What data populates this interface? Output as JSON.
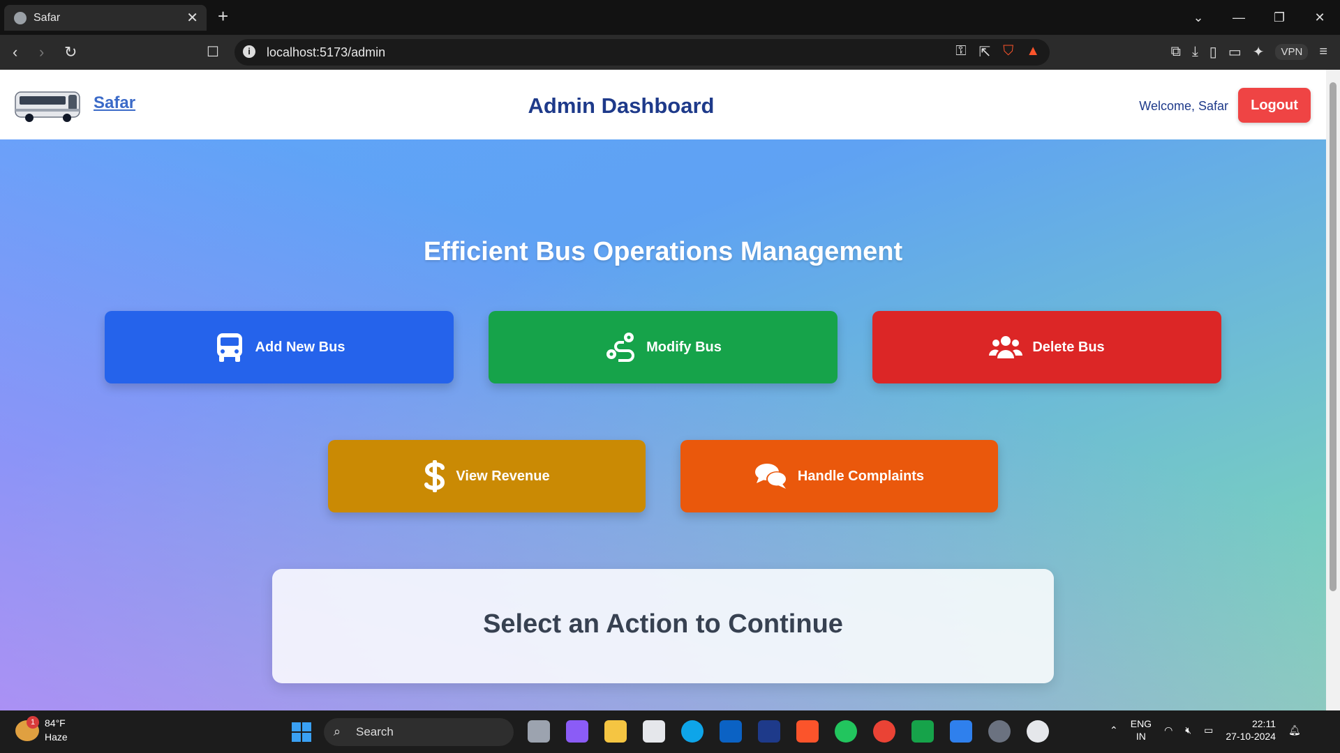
{
  "browser": {
    "tab_title": "Safar",
    "tab_close": "✕",
    "new_tab": "+",
    "url": "localhost:5173/admin",
    "vpn_label": "VPN",
    "window_controls": [
      "⌄",
      "—",
      "❐",
      "✕"
    ]
  },
  "header": {
    "brand": "Safar",
    "title": "Admin Dashboard",
    "welcome": "Welcome, Safar",
    "logout": "Logout"
  },
  "main": {
    "headline": "Efficient Bus Operations Management",
    "actions": [
      {
        "label": "Add New Bus",
        "icon": "bus-icon",
        "color": "#2563eb"
      },
      {
        "label": "Modify Bus",
        "icon": "route-icon",
        "color": "#16a34a"
      },
      {
        "label": "Delete Bus",
        "icon": "users-icon",
        "color": "#dc2626"
      },
      {
        "label": "View Revenue",
        "icon": "dollar-icon",
        "color": "#ca8a04"
      },
      {
        "label": "Handle Complaints",
        "icon": "comments-icon",
        "color": "#ea580c"
      }
    ],
    "panel_text": "Select an Action to Continue"
  },
  "taskbar": {
    "weather_badge": "1",
    "temperature": "84°F",
    "condition": "Haze",
    "search_label": "Search",
    "lang_line1": "ENG",
    "lang_line2": "IN",
    "time": "22:11",
    "date": "27-10-2024"
  },
  "colors": {
    "logout": "#ef4444",
    "title": "#1e3a8a"
  }
}
